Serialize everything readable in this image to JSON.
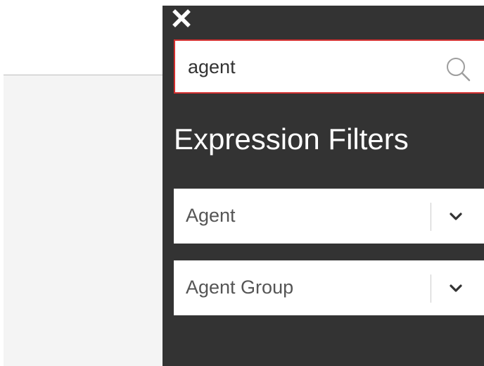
{
  "search": {
    "value": "agent",
    "icon": "search-icon"
  },
  "close": {
    "icon": "close-icon"
  },
  "filters_panel": {
    "title": "Expression Filters",
    "filters": [
      {
        "label": "Agent",
        "icon": "chevron-down-icon"
      },
      {
        "label": "Agent Group",
        "icon": "chevron-down-icon"
      }
    ]
  },
  "colors": {
    "panel_background": "#333333",
    "search_border": "#d32f2f",
    "text_light": "#ffffff",
    "text_dark": "#555555"
  }
}
